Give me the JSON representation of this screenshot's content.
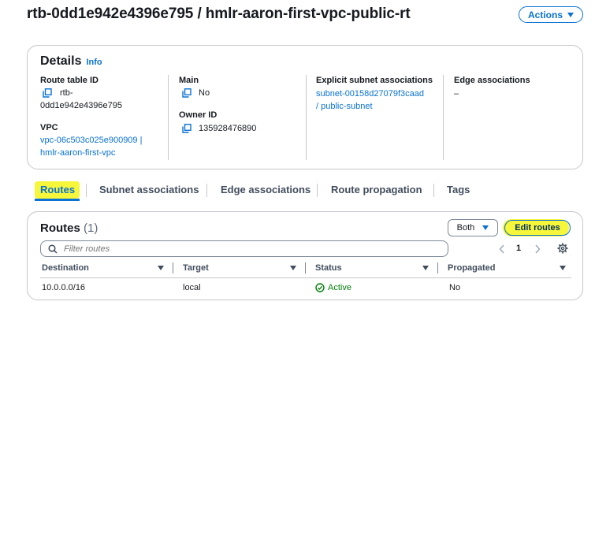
{
  "page": {
    "title": "rtb-0dd1e942e4396e795 / hmlr-aaron-first-vpc-public-rt",
    "actions_label": "Actions"
  },
  "details": {
    "heading": "Details",
    "info_label": "Info",
    "route_table_id_label": "Route table ID",
    "route_table_id_line1": "rtb-",
    "route_table_id_line2": "0dd1e942e4396e795",
    "vpc_label": "VPC",
    "vpc_link_line1": "vpc-06c503c025e900909 |",
    "vpc_link_line2": "hmlr-aaron-first-vpc",
    "main_label": "Main",
    "main_value": "No",
    "owner_id_label": "Owner ID",
    "owner_id_value": "135928476890",
    "explicit_subnet_label": "Explicit subnet associations",
    "explicit_subnet_line1": "subnet-00158d27079f3caad",
    "explicit_subnet_line2": "/ public-subnet",
    "edge_assoc_label": "Edge associations",
    "edge_assoc_value": "–"
  },
  "tabs": [
    {
      "label": "Routes",
      "active": true
    },
    {
      "label": "Subnet associations",
      "active": false
    },
    {
      "label": "Edge associations",
      "active": false
    },
    {
      "label": "Route propagation",
      "active": false
    },
    {
      "label": "Tags",
      "active": false
    }
  ],
  "routes": {
    "title": "Routes",
    "count": "(1)",
    "filter_select": "Both",
    "edit_label": "Edit routes",
    "filter_placeholder": "Filter routes",
    "page_number": "1",
    "columns": [
      "Destination",
      "Target",
      "Status",
      "Propagated"
    ],
    "rows": [
      {
        "destination": "10.0.0.0/16",
        "target": "local",
        "status": "Active",
        "propagated": "No"
      }
    ]
  },
  "colors": {
    "link": "#0972d3",
    "success": "#037f0c",
    "highlight": "#f6f63a"
  },
  "icons": [
    "copy-icon",
    "search-icon",
    "chevron-left-icon",
    "chevron-right-icon",
    "settings-gear-icon",
    "status-check-icon",
    "caret-down-icon",
    "sort-caret-icon"
  ]
}
